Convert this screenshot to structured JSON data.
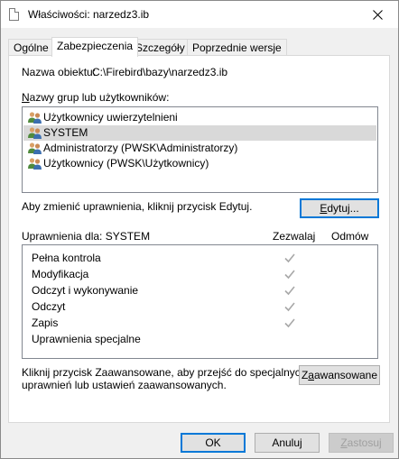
{
  "window": {
    "title": "Właściwości: narzedz3.ib",
    "icons": {
      "file": "document-icon",
      "close": "close-icon"
    }
  },
  "tabs": [
    {
      "label": "Ogólne",
      "active": false
    },
    {
      "label": "Zabezpieczenia",
      "active": true
    },
    {
      "label": "Szczegóły",
      "active": false
    },
    {
      "label": "Poprzednie wersje",
      "active": false
    }
  ],
  "security": {
    "object_name_label": "Nazwa obiektu:",
    "object_name_value": "C:\\Firebird\\bazy\\narzedz3.ib",
    "groups_label": "Nazwy grup lub użytkowników:",
    "groups": [
      {
        "label": "Użytkownicy uwierzytelnieni",
        "icon": "users-icon",
        "selected": false
      },
      {
        "label": "SYSTEM",
        "icon": "users-icon",
        "selected": true
      },
      {
        "label": "Administratorzy (PWSK\\Administratorzy)",
        "icon": "users-icon",
        "selected": false
      },
      {
        "label": "Użytkownicy (PWSK\\Użytkownicy)",
        "icon": "users-icon",
        "selected": false
      }
    ],
    "edit_hint": "Aby zmienić uprawnienia, kliknij przycisk Edytuj.",
    "edit_button": "Edytuj...",
    "permissions_label": "Uprawnienia dla: SYSTEM",
    "allow_header": "Zezwalaj",
    "deny_header": "Odmów",
    "permissions": [
      {
        "name": "Pełna kontrola",
        "allow": true,
        "deny": false
      },
      {
        "name": "Modyfikacja",
        "allow": true,
        "deny": false
      },
      {
        "name": "Odczyt i wykonywanie",
        "allow": true,
        "deny": false
      },
      {
        "name": "Odczyt",
        "allow": true,
        "deny": false
      },
      {
        "name": "Zapis",
        "allow": true,
        "deny": false
      },
      {
        "name": "Uprawnienia specjalne",
        "allow": false,
        "deny": false
      }
    ],
    "advanced_hint_line1": "Kliknij przycisk Zaawansowane, aby przejść do specjalnych",
    "advanced_hint_line2": "uprawnień lub ustawień zaawansowanych.",
    "advanced_button": "Zaawansowane"
  },
  "footer": {
    "ok": "OK",
    "cancel": "Anuluj",
    "apply": "Zastosuj"
  }
}
